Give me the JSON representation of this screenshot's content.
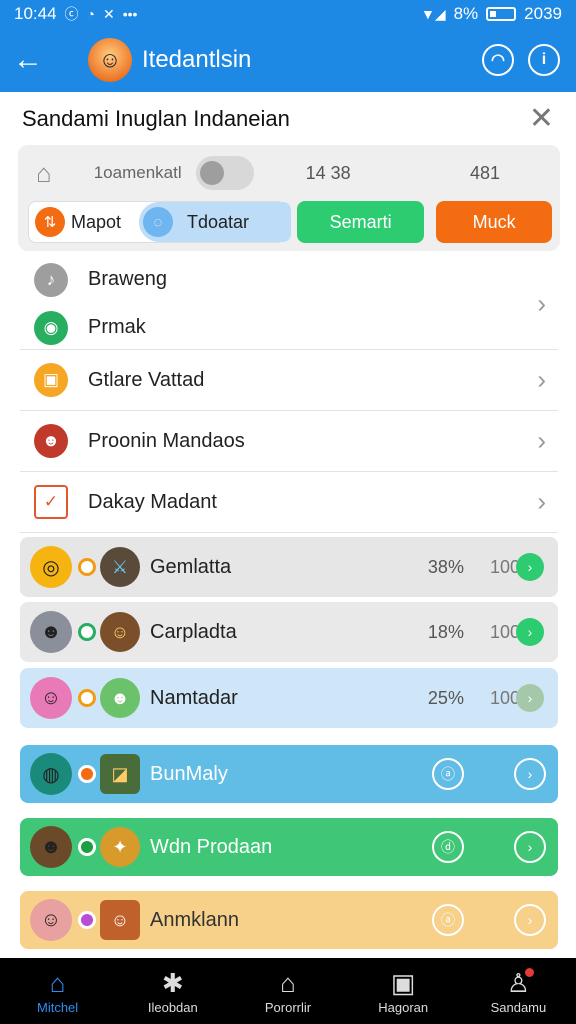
{
  "status_bar": {
    "time": "10:44",
    "battery": "8%",
    "clock_right": "2039"
  },
  "app_bar": {
    "title": "Itedantlsin"
  },
  "dialog": {
    "title": "Sandami Inuglan Indaneian"
  },
  "panel": {
    "label": "1oamenkatl",
    "num1": "14 38",
    "num2": "481",
    "seg1_label": "Mapot",
    "seg2_label": "Tdoatar",
    "seg3_label": "Semarti",
    "seg4_label": "Muck"
  },
  "list": [
    {
      "label": "Braweng"
    },
    {
      "label": "Prmak"
    },
    {
      "label": "Gtlare Vattad"
    },
    {
      "label": "Proonin Mandaos"
    },
    {
      "label": "Dakay Madant"
    }
  ],
  "games": [
    {
      "name": "Gemlatta",
      "percent": "38%",
      "max": "100"
    },
    {
      "name": "Carpladta",
      "percent": "18%",
      "max": "100"
    },
    {
      "name": "Namtadar",
      "percent": "25%",
      "max": "100"
    }
  ],
  "bars": [
    {
      "name": "BunMaly"
    },
    {
      "name": "Wdn Prodaan"
    },
    {
      "name": "Anmklann"
    }
  ],
  "bottom_nav": [
    {
      "label": "Mitchel"
    },
    {
      "label": "Ileobdan"
    },
    {
      "label": "Pororrlir"
    },
    {
      "label": "Hagoran"
    },
    {
      "label": "Sandamu"
    }
  ],
  "colors": {
    "primary": "#1e88e5",
    "green": "#2ecc71",
    "orange": "#f36c12"
  }
}
